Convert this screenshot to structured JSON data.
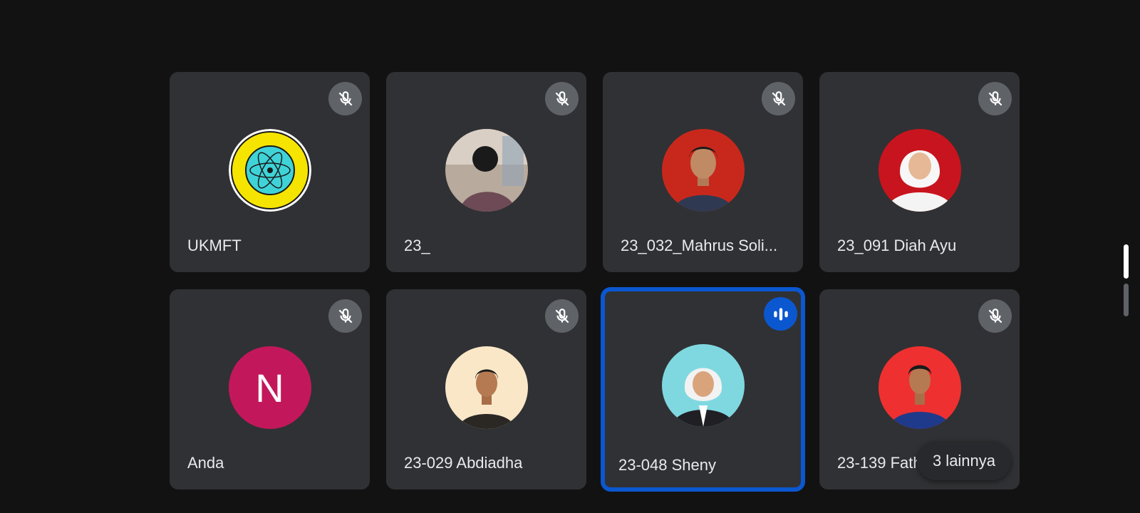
{
  "participants": [
    {
      "name": "UKMFT",
      "mic": "muted-mic-icon"
    },
    {
      "name": "23_",
      "mic": "muted-mic-icon"
    },
    {
      "name": "23_032_Mahrus Soli...",
      "mic": "muted-mic-icon"
    },
    {
      "name": "23_091 Diah Ayu",
      "mic": "muted-mic-icon"
    },
    {
      "name": "Anda",
      "initial": "N",
      "avatar_color": "#c2185b",
      "mic": "muted-mic-icon"
    },
    {
      "name": "23-029 Abdiadha",
      "mic": "muted-mic-icon"
    },
    {
      "name": "23-048 Sheny",
      "mic": "speaking-audio-icon",
      "speaking": true
    },
    {
      "name": "23-139 Fathu...",
      "mic": "muted-mic-icon"
    }
  ],
  "more_participants": {
    "label": "3 lainnya"
  },
  "colors": {
    "background": "#121212",
    "tile": "#303134",
    "speaking_border": "#0b57d0",
    "mic_badge": "#5f6368"
  }
}
